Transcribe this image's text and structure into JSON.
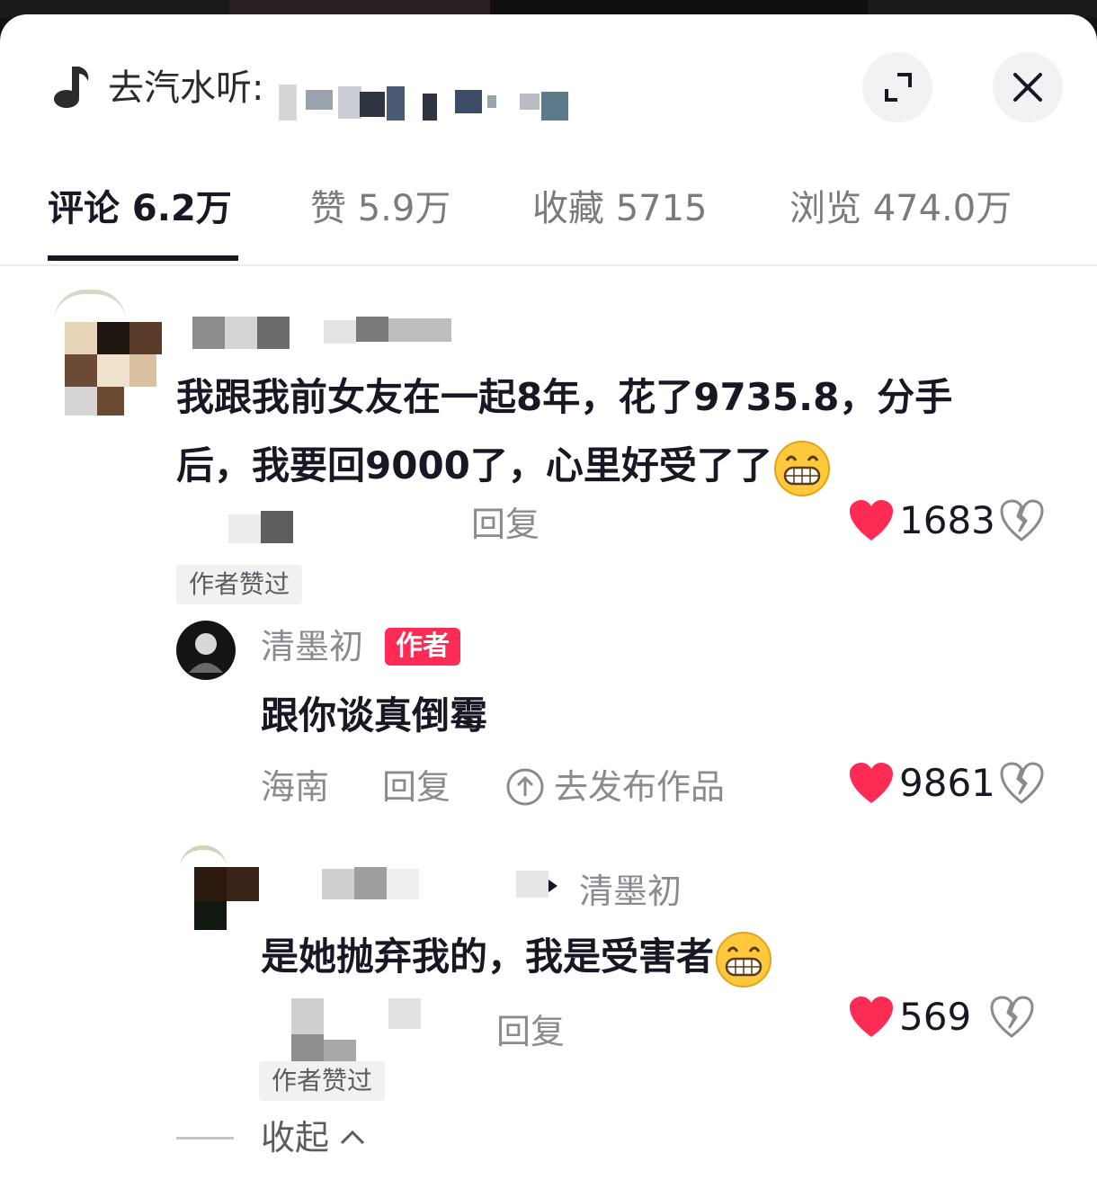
{
  "header": {
    "title": "去汽水听:",
    "icons": {
      "music": "music-note-icon",
      "expand": "expand-icon",
      "close": "close-icon"
    }
  },
  "tabs": [
    {
      "label": "评论 6.2万",
      "active": true
    },
    {
      "label": "赞 5.9万",
      "active": false
    },
    {
      "label": "收藏 5715",
      "active": false
    },
    {
      "label": "浏览 474.0万",
      "active": false
    }
  ],
  "comments": [
    {
      "text_line1": "我跟我前女友在一起8年，花了9735.8，分手",
      "text_line2": "后，我要回9000了，心里好受了了",
      "reply_label": "回复",
      "likes": "1683",
      "badge": "作者赞过"
    }
  ],
  "replies": [
    {
      "author": "清墨初",
      "tag": "作者",
      "text": "跟你谈真倒霉",
      "location": "海南",
      "reply_label": "回复",
      "publish_label": "去发布作品",
      "likes": "9861"
    },
    {
      "reply_to": "清墨初",
      "text": "是她抛弃我的，我是受害者",
      "reply_label": "回复",
      "likes": "569",
      "badge": "作者赞过"
    }
  ],
  "footer": {
    "collapse_label": "收起"
  },
  "colors": {
    "like_red": "#fe2c55",
    "text": "#161823",
    "muted": "#8a8b91",
    "tag_bg": "#fe2c55"
  }
}
